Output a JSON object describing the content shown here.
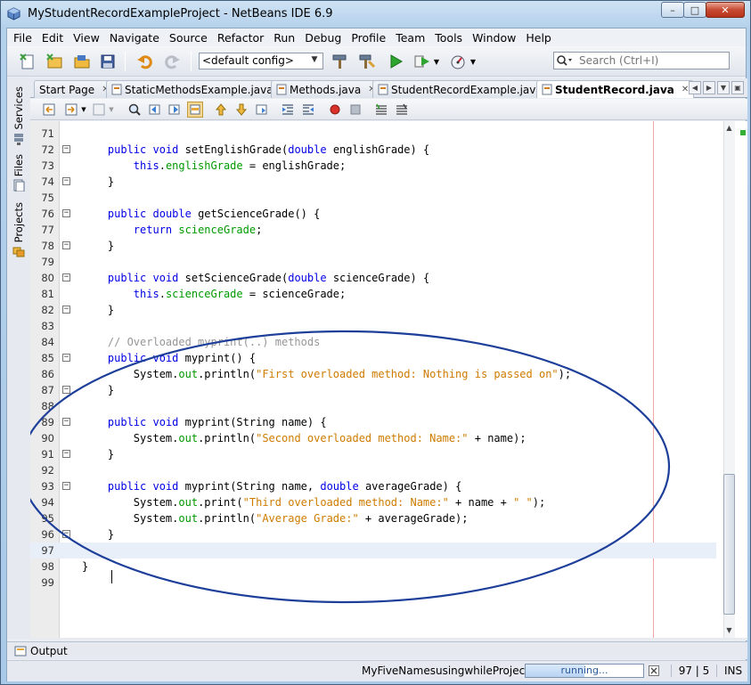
{
  "window": {
    "title": "MyStudentRecordExampleProject - NetBeans IDE 6.9",
    "minimize_glyph": "–",
    "maximize_glyph": "□",
    "close_glyph": "✕"
  },
  "menubar": [
    "File",
    "Edit",
    "View",
    "Navigate",
    "Source",
    "Refactor",
    "Run",
    "Debug",
    "Profile",
    "Team",
    "Tools",
    "Window",
    "Help"
  ],
  "toolbar": {
    "config_value": "<default config>",
    "search_placeholder": "Search (Ctrl+I)"
  },
  "side_tabs": [
    "Services",
    "Files",
    "Projects"
  ],
  "editor_tabs": [
    {
      "label": "Start Page",
      "active": false
    },
    {
      "label": "StaticMethodsExample.java",
      "active": false
    },
    {
      "label": "Methods.java",
      "active": false
    },
    {
      "label": "StudentRecordExample.java",
      "active": false
    },
    {
      "label": "StudentRecord.java",
      "active": true
    }
  ],
  "tab_close_glyph": "✕",
  "tab_nav_glyphs": [
    "◀",
    "▶",
    "▼",
    "▣"
  ],
  "code_lines": [
    {
      "n": "71",
      "fold": "",
      "tokens": []
    },
    {
      "n": "72",
      "fold": "−",
      "tokens": [
        [
          "",
          "    "
        ],
        [
          "kw",
          "public"
        ],
        [
          "",
          " "
        ],
        [
          "kw",
          "void"
        ],
        [
          "",
          " setEnglishGrade("
        ],
        [
          "kw",
          "double"
        ],
        [
          "",
          " englishGrade) {"
        ]
      ]
    },
    {
      "n": "73",
      "fold": "",
      "tokens": [
        [
          "",
          "        "
        ],
        [
          "kw",
          "this"
        ],
        [
          "",
          "."
        ],
        [
          "fld",
          "englishGrade"
        ],
        [
          "",
          " = englishGrade;"
        ]
      ]
    },
    {
      "n": "74",
      "fold": "−",
      "tokens": [
        [
          "",
          "    }"
        ]
      ]
    },
    {
      "n": "75",
      "fold": "",
      "tokens": []
    },
    {
      "n": "76",
      "fold": "−",
      "tokens": [
        [
          "",
          "    "
        ],
        [
          "kw",
          "public"
        ],
        [
          "",
          " "
        ],
        [
          "kw",
          "double"
        ],
        [
          "",
          " getScienceGrade() {"
        ]
      ]
    },
    {
      "n": "77",
      "fold": "",
      "tokens": [
        [
          "",
          "        "
        ],
        [
          "kw",
          "return"
        ],
        [
          "",
          " "
        ],
        [
          "fld",
          "scienceGrade"
        ],
        [
          "",
          ";"
        ]
      ]
    },
    {
      "n": "78",
      "fold": "−",
      "tokens": [
        [
          "",
          "    }"
        ]
      ]
    },
    {
      "n": "79",
      "fold": "",
      "tokens": []
    },
    {
      "n": "80",
      "fold": "−",
      "tokens": [
        [
          "",
          "    "
        ],
        [
          "kw",
          "public"
        ],
        [
          "",
          " "
        ],
        [
          "kw",
          "void"
        ],
        [
          "",
          " setScienceGrade("
        ],
        [
          "kw",
          "double"
        ],
        [
          "",
          " scienceGrade) {"
        ]
      ]
    },
    {
      "n": "81",
      "fold": "",
      "tokens": [
        [
          "",
          "        "
        ],
        [
          "kw",
          "this"
        ],
        [
          "",
          "."
        ],
        [
          "fld",
          "scienceGrade"
        ],
        [
          "",
          " = scienceGrade;"
        ]
      ]
    },
    {
      "n": "82",
      "fold": "−",
      "tokens": [
        [
          "",
          "    }"
        ]
      ]
    },
    {
      "n": "83",
      "fold": "",
      "tokens": []
    },
    {
      "n": "84",
      "fold": "",
      "tokens": [
        [
          "",
          "    "
        ],
        [
          "cmt",
          "// Overloaded myprint(..) methods"
        ]
      ]
    },
    {
      "n": "85",
      "fold": "−",
      "tokens": [
        [
          "",
          "    "
        ],
        [
          "kw",
          "public"
        ],
        [
          "",
          " "
        ],
        [
          "kw",
          "void"
        ],
        [
          "",
          " myprint() {"
        ]
      ]
    },
    {
      "n": "86",
      "fold": "",
      "tokens": [
        [
          "",
          "        System."
        ],
        [
          "fld",
          "out"
        ],
        [
          "",
          ".println("
        ],
        [
          "str",
          "\"First overloaded method: Nothing is passed on\""
        ],
        [
          "",
          ");"
        ]
      ]
    },
    {
      "n": "87",
      "fold": "−",
      "tokens": [
        [
          "",
          "    }"
        ]
      ]
    },
    {
      "n": "88",
      "fold": "",
      "tokens": []
    },
    {
      "n": "89",
      "fold": "−",
      "tokens": [
        [
          "",
          "    "
        ],
        [
          "kw",
          "public"
        ],
        [
          "",
          " "
        ],
        [
          "kw",
          "void"
        ],
        [
          "",
          " myprint(String name) {"
        ]
      ]
    },
    {
      "n": "90",
      "fold": "",
      "tokens": [
        [
          "",
          "        System."
        ],
        [
          "fld",
          "out"
        ],
        [
          "",
          ".println("
        ],
        [
          "str",
          "\"Second overloaded method: Name:\""
        ],
        [
          "",
          " + name);"
        ]
      ]
    },
    {
      "n": "91",
      "fold": "−",
      "tokens": [
        [
          "",
          "    }"
        ]
      ]
    },
    {
      "n": "92",
      "fold": "",
      "tokens": []
    },
    {
      "n": "93",
      "fold": "−",
      "tokens": [
        [
          "",
          "    "
        ],
        [
          "kw",
          "public"
        ],
        [
          "",
          " "
        ],
        [
          "kw",
          "void"
        ],
        [
          "",
          " myprint(String name, "
        ],
        [
          "kw",
          "double"
        ],
        [
          "",
          " averageGrade) {"
        ]
      ]
    },
    {
      "n": "94",
      "fold": "",
      "tokens": [
        [
          "",
          "        System."
        ],
        [
          "fld",
          "out"
        ],
        [
          "",
          ".print("
        ],
        [
          "str",
          "\"Third overloaded method: Name:\""
        ],
        [
          "",
          " + name + "
        ],
        [
          "str",
          "\" \""
        ],
        [
          "",
          ");"
        ]
      ]
    },
    {
      "n": "95",
      "fold": "",
      "tokens": [
        [
          "",
          "        System."
        ],
        [
          "fld",
          "out"
        ],
        [
          "",
          ".println("
        ],
        [
          "str",
          "\"Average Grade:\""
        ],
        [
          "",
          " + averageGrade);"
        ]
      ]
    },
    {
      "n": "96",
      "fold": "−",
      "tokens": [
        [
          "",
          "    }"
        ]
      ]
    },
    {
      "n": "97",
      "fold": "",
      "tokens": [],
      "current": true
    },
    {
      "n": "98",
      "fold": "",
      "tokens": [
        [
          "",
          "}"
        ]
      ]
    },
    {
      "n": "99",
      "fold": "",
      "tokens": []
    }
  ],
  "output": {
    "label": "Output"
  },
  "status": {
    "task": "MyFiveNamesusingwhileProject (run)",
    "progress_text": "running...",
    "progress_fraction": 0.5,
    "position": "97 | 5",
    "mode": "INS"
  },
  "colors": {
    "keyword": "#0000e6",
    "field": "#009900",
    "string": "#ce7b00",
    "comment": "#969696",
    "annotation_ellipse": "#1d3f9a"
  }
}
